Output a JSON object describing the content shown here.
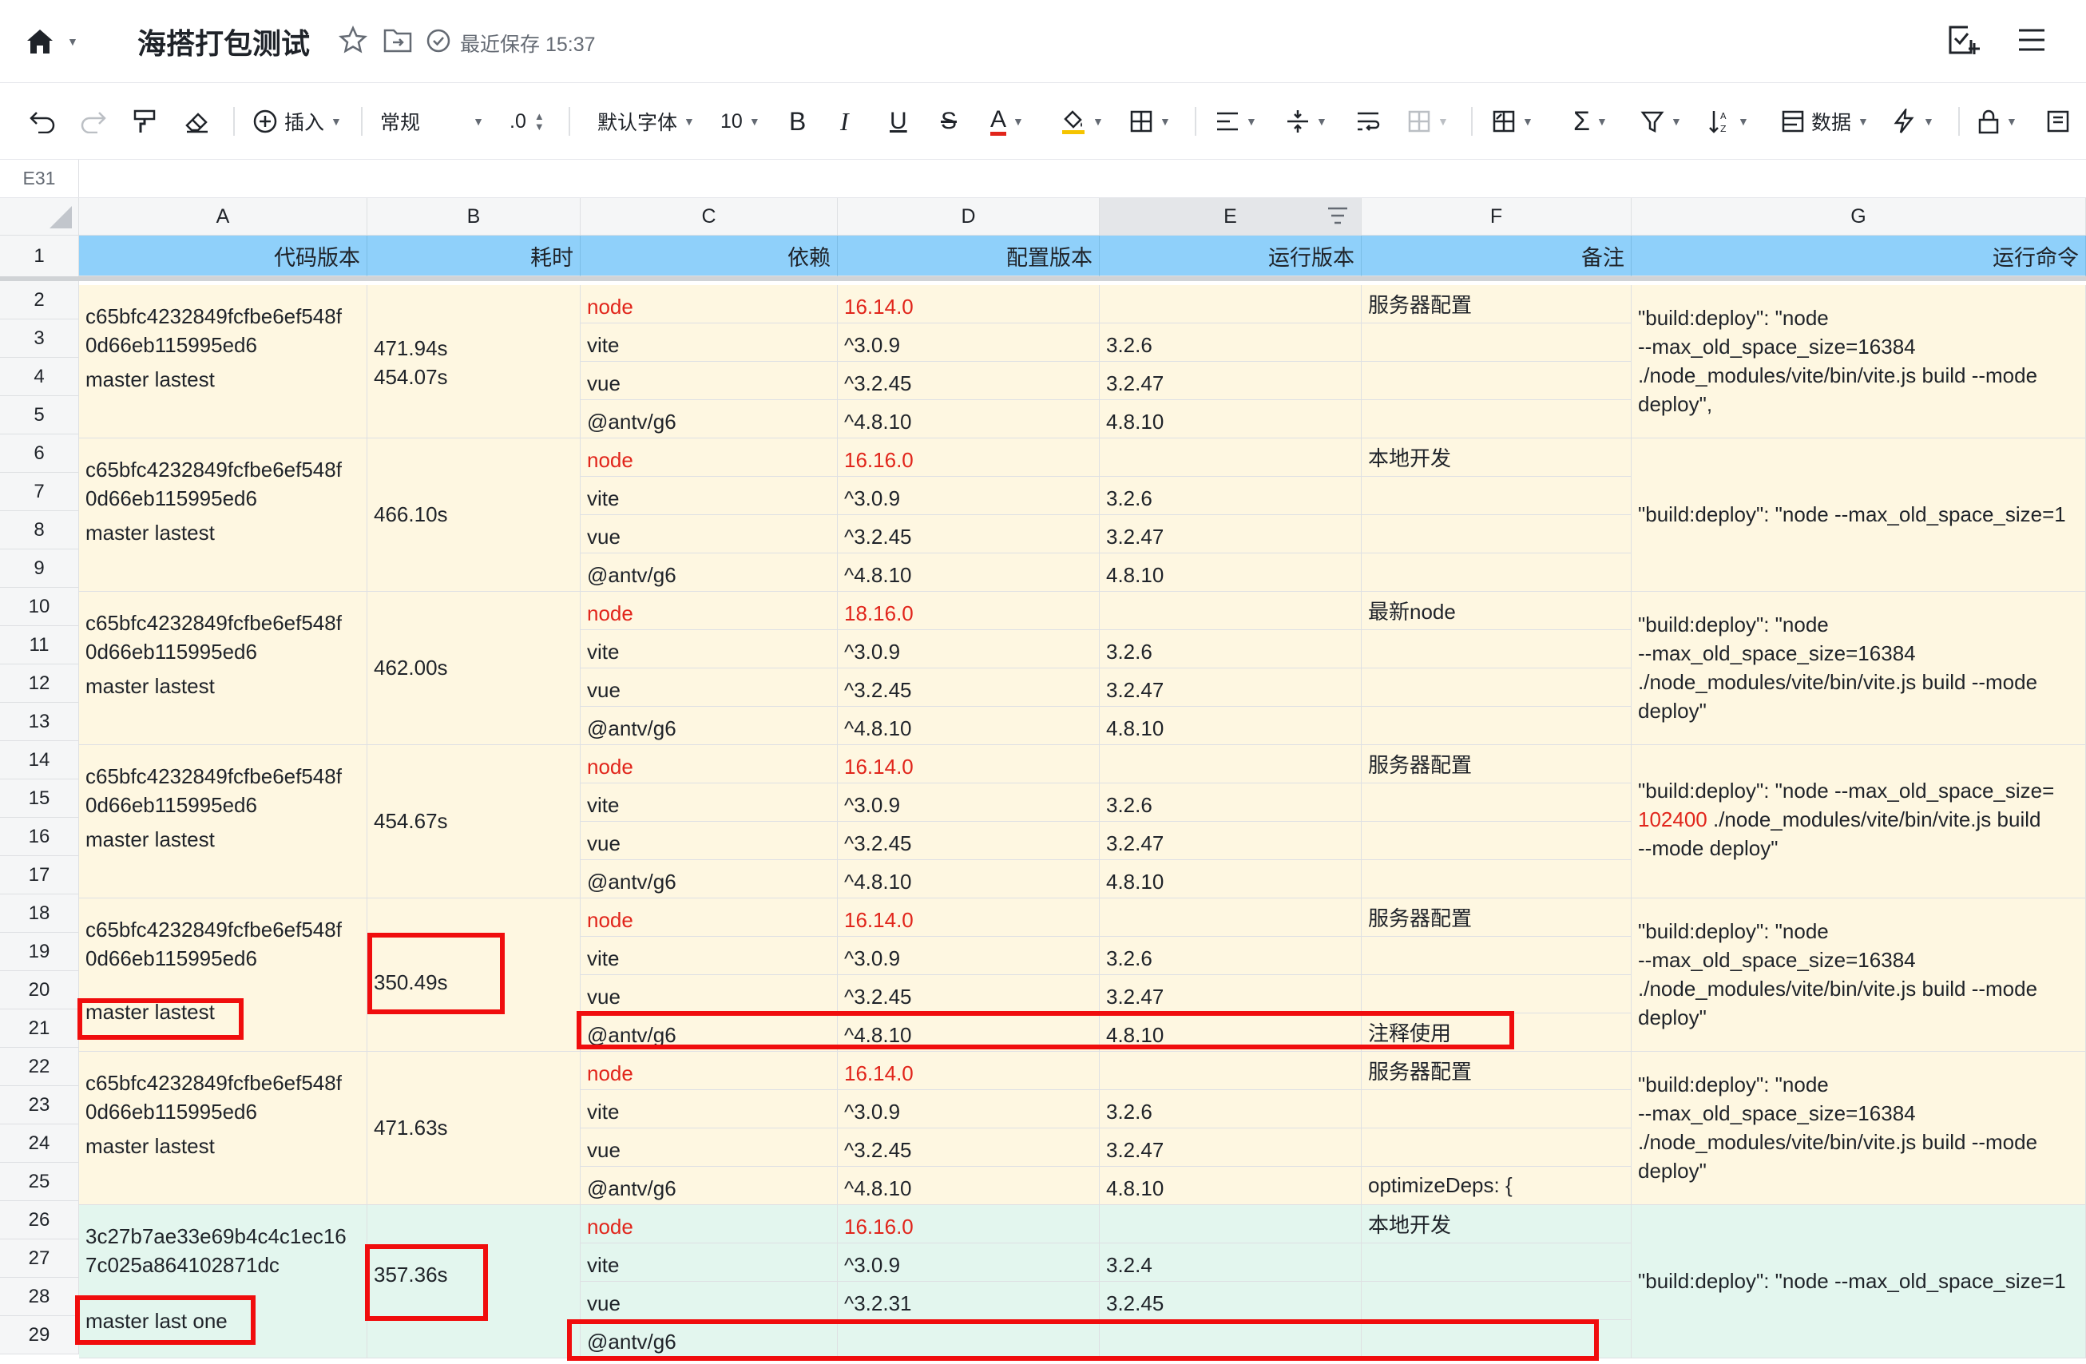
{
  "titlebar": {
    "doc_title": "海搭打包测试",
    "save_status": "最近保存 15:37"
  },
  "toolbar": {
    "insert_label": "插入",
    "format_label": "常规",
    "decimal_label": ".0",
    "font_label": "默认字体",
    "font_size": "10",
    "bold": "B",
    "italic": "I",
    "underline": "U",
    "strike": "S",
    "font_color": "A",
    "data_label": "数据"
  },
  "formula": {
    "cell_ref": "E31"
  },
  "columns": [
    "A",
    "B",
    "C",
    "D",
    "E",
    "F",
    "G"
  ],
  "header_row": {
    "row_num": "1",
    "cells": [
      "代码版本",
      "耗时",
      "依赖",
      "配置版本",
      "运行版本",
      "备注",
      "运行命令"
    ]
  },
  "row_numbers": [
    "2",
    "3",
    "4",
    "5",
    "6",
    "7",
    "8",
    "9",
    "10",
    "11",
    "12",
    "13",
    "14",
    "15",
    "16",
    "17",
    "18",
    "19",
    "20",
    "21",
    "22",
    "23",
    "24",
    "25",
    "26",
    "27",
    "28",
    "29"
  ],
  "groups": [
    {
      "commit_l1": "c65bfc4232849fcfbe6ef548f",
      "commit_l2": "0d66eb115995ed6",
      "branch": "master lastest",
      "time_l1": "471.94s",
      "time_l2": "454.07s",
      "deps": [
        "node",
        "vite",
        "vue",
        "@antv/g6"
      ],
      "cfg": [
        "16.14.0",
        "^3.0.9",
        "^3.2.45",
        "^4.8.10"
      ],
      "run": [
        "",
        "3.2.6",
        "3.2.47",
        "4.8.10"
      ],
      "note": [
        "服务器配置",
        "",
        "",
        ""
      ],
      "cmd": [
        "\"build:deploy\": \"node",
        "--max_old_space_size=16384",
        "./node_modules/vite/bin/vite.js build --mode",
        "deploy\","
      ]
    },
    {
      "commit_l1": "c65bfc4232849fcfbe6ef548f",
      "commit_l2": "0d66eb115995ed6",
      "branch": "master lastest",
      "time_l1": "466.10s",
      "deps": [
        "node",
        "vite",
        "vue",
        "@antv/g6"
      ],
      "cfg": [
        "16.16.0",
        "^3.0.9",
        "^3.2.45",
        "^4.8.10"
      ],
      "run": [
        "",
        "3.2.6",
        "3.2.47",
        "4.8.10"
      ],
      "note": [
        "本地开发",
        "",
        "",
        ""
      ],
      "cmd": [
        "\"build:deploy\": \"node --max_old_space_size=1"
      ]
    },
    {
      "commit_l1": "c65bfc4232849fcfbe6ef548f",
      "commit_l2": "0d66eb115995ed6",
      "branch": "master lastest",
      "time_l1": "462.00s",
      "deps": [
        "node",
        "vite",
        "vue",
        "@antv/g6"
      ],
      "cfg": [
        "18.16.0",
        "^3.0.9",
        "^3.2.45",
        "^4.8.10"
      ],
      "run": [
        "",
        "3.2.6",
        "3.2.47",
        "4.8.10"
      ],
      "note": [
        "最新node",
        "",
        "",
        ""
      ],
      "cmd": [
        "\"build:deploy\": \"node",
        "--max_old_space_size=16384",
        "./node_modules/vite/bin/vite.js build --mode",
        "deploy\""
      ]
    },
    {
      "commit_l1": "c65bfc4232849fcfbe6ef548f",
      "commit_l2": "0d66eb115995ed6",
      "branch": "master lastest",
      "time_l1": "454.67s",
      "deps": [
        "node",
        "vite",
        "vue",
        "@antv/g6"
      ],
      "cfg": [
        "16.14.0",
        "^3.0.9",
        "^3.2.45",
        "^4.8.10"
      ],
      "run": [
        "",
        "3.2.6",
        "3.2.47",
        "4.8.10"
      ],
      "note": [
        "服务器配置",
        "",
        "",
        ""
      ],
      "cmd_l1": "\"build:deploy\": \"node --max_old_space_size=",
      "cmd_red": "102400",
      "cmd_l2_rest": " ./node_modules/vite/bin/vite.js build",
      "cmd_l3": "--mode deploy\""
    },
    {
      "commit_l1": "c65bfc4232849fcfbe6ef548f",
      "commit_l2": "0d66eb115995ed6",
      "branch": "master lastest",
      "time_l1": "350.49s",
      "deps": [
        "node",
        "vite",
        "vue",
        "@antv/g6"
      ],
      "cfg": [
        "16.14.0",
        "^3.0.9",
        "^3.2.45",
        "^4.8.10"
      ],
      "run": [
        "",
        "3.2.6",
        "3.2.47",
        "4.8.10"
      ],
      "note": [
        "服务器配置",
        "",
        "",
        "注释使用"
      ],
      "cmd": [
        "\"build:deploy\": \"node",
        "--max_old_space_size=16384",
        "./node_modules/vite/bin/vite.js build --mode",
        "deploy\""
      ]
    },
    {
      "commit_l1": "c65bfc4232849fcfbe6ef548f",
      "commit_l2": "0d66eb115995ed6",
      "branch": "master lastest",
      "time_l1": "471.63s",
      "deps": [
        "node",
        "vite",
        "vue",
        "@antv/g6"
      ],
      "cfg": [
        "16.14.0",
        "^3.0.9",
        "^3.2.45",
        "^4.8.10"
      ],
      "run": [
        "",
        "3.2.6",
        "3.2.47",
        "4.8.10"
      ],
      "note": [
        "服务器配置",
        "",
        "",
        "optimizeDeps: {"
      ],
      "cmd": [
        "\"build:deploy\": \"node",
        "--max_old_space_size=16384",
        "./node_modules/vite/bin/vite.js build --mode",
        "deploy\""
      ]
    },
    {
      "commit_l1": "3c27b7ae33e69b4c4c1ec16",
      "commit_l2": "7c025a864102871dc",
      "branch": "master last one",
      "time_l1": "357.36s",
      "deps": [
        "node",
        "vite",
        "vue",
        "@antv/g6"
      ],
      "cfg": [
        "16.16.0",
        "^3.0.9",
        "^3.2.31",
        ""
      ],
      "run": [
        "",
        "3.2.4",
        "3.2.45",
        ""
      ],
      "note": [
        "本地开发",
        "",
        "",
        ""
      ],
      "cmd": [
        "\"build:deploy\": \"node --max_old_space_size=1"
      ]
    }
  ]
}
